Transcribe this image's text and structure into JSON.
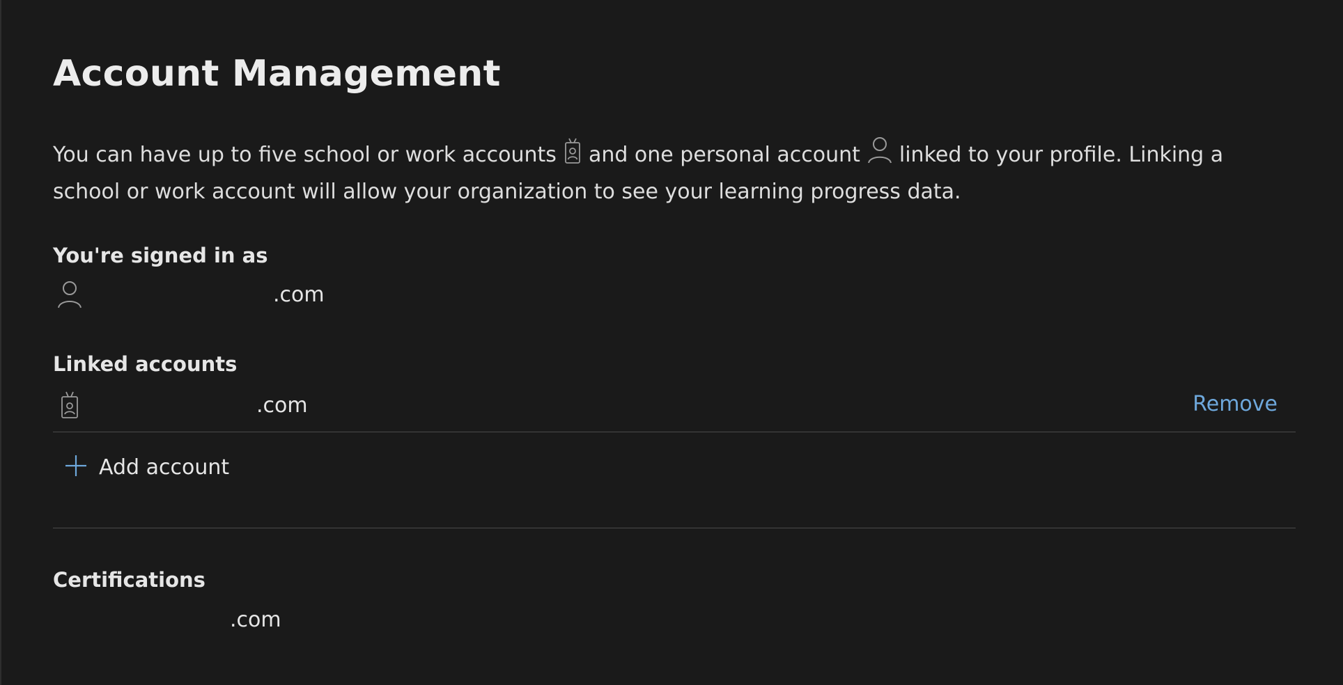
{
  "header": {
    "title": "Account Management"
  },
  "intro": {
    "part1": "You can have up to five school or work accounts",
    "work_icon": "work-badge-icon",
    "part2": "and one personal account",
    "personal_icon": "person-icon",
    "part3": "linked to your profile. Linking a school or work account will allow your organization to see your learning progress data."
  },
  "signed_in": {
    "label": "You're signed in as",
    "icon": "person-icon",
    "email_suffix": ".com"
  },
  "linked_accounts": {
    "label": "Linked accounts",
    "items": [
      {
        "icon": "work-badge-icon",
        "email_suffix": ".com",
        "action_label": "Remove"
      }
    ],
    "add_label": "Add account"
  },
  "certifications": {
    "label": "Certifications",
    "email_suffix": ".com"
  },
  "colors": {
    "background": "#1a1a1a",
    "text": "#e6e6e6",
    "accent": "#6ea8dc",
    "divider": "#4a4a4a"
  }
}
